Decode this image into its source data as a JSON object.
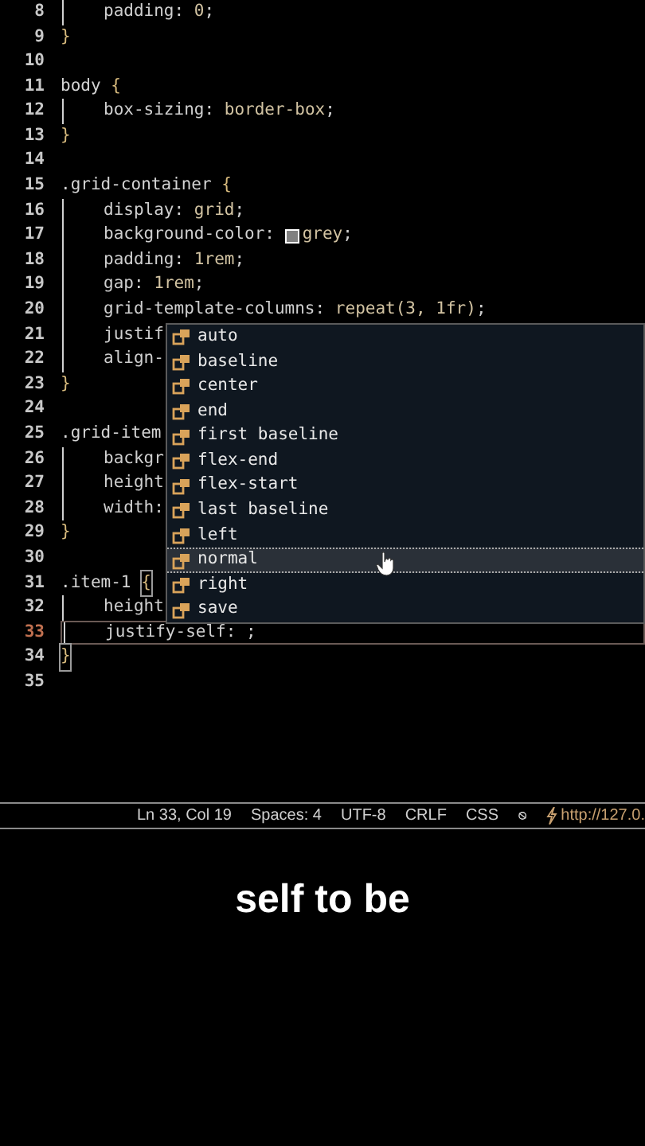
{
  "editor": {
    "lines": [
      {
        "number": "8",
        "guide": true,
        "current": false,
        "segments": [
          {
            "kind": "property",
            "text": "padding"
          },
          {
            "kind": "punct",
            "text": ": "
          },
          {
            "kind": "value",
            "text": "0"
          },
          {
            "kind": "punct",
            "text": ";"
          }
        ]
      },
      {
        "number": "9",
        "guide": false,
        "current": false,
        "segments": [
          {
            "kind": "brace",
            "text": "}"
          }
        ]
      },
      {
        "number": "10",
        "guide": false,
        "current": false
      },
      {
        "number": "11",
        "guide": false,
        "current": false,
        "segments": [
          {
            "kind": "selector",
            "text": "body "
          },
          {
            "kind": "brace",
            "text": "{"
          }
        ]
      },
      {
        "number": "12",
        "guide": true,
        "current": false,
        "segments": [
          {
            "kind": "property",
            "text": "box-sizing"
          },
          {
            "kind": "punct",
            "text": ": "
          },
          {
            "kind": "value",
            "text": "border-box"
          },
          {
            "kind": "punct",
            "text": ";"
          }
        ]
      },
      {
        "number": "13",
        "guide": false,
        "current": false,
        "segments": [
          {
            "kind": "brace",
            "text": "}"
          }
        ]
      },
      {
        "number": "14",
        "guide": false,
        "current": false
      },
      {
        "number": "15",
        "guide": false,
        "current": false,
        "segments": [
          {
            "kind": "selector",
            "text": ".grid-container "
          },
          {
            "kind": "brace",
            "text": "{"
          }
        ]
      },
      {
        "number": "16",
        "guide": true,
        "current": false,
        "segments": [
          {
            "kind": "property",
            "text": "display"
          },
          {
            "kind": "punct",
            "text": ": "
          },
          {
            "kind": "value",
            "text": "grid"
          },
          {
            "kind": "punct",
            "text": ";"
          }
        ]
      },
      {
        "number": "17",
        "guide": true,
        "current": false,
        "segments": [
          {
            "kind": "property",
            "text": "background-color"
          },
          {
            "kind": "punct",
            "text": ": "
          },
          {
            "kind": "swatch",
            "color": "#808080"
          },
          {
            "kind": "value",
            "text": "grey"
          },
          {
            "kind": "punct",
            "text": ";"
          }
        ]
      },
      {
        "number": "18",
        "guide": true,
        "current": false,
        "segments": [
          {
            "kind": "property",
            "text": "padding"
          },
          {
            "kind": "punct",
            "text": ": "
          },
          {
            "kind": "value",
            "text": "1rem"
          },
          {
            "kind": "punct",
            "text": ";"
          }
        ]
      },
      {
        "number": "19",
        "guide": true,
        "current": false,
        "segments": [
          {
            "kind": "property",
            "text": "gap"
          },
          {
            "kind": "punct",
            "text": ": "
          },
          {
            "kind": "value",
            "text": "1rem"
          },
          {
            "kind": "punct",
            "text": ";"
          }
        ]
      },
      {
        "number": "20",
        "guide": true,
        "current": false,
        "segments": [
          {
            "kind": "property",
            "text": "grid-template-columns"
          },
          {
            "kind": "punct",
            "text": ": "
          },
          {
            "kind": "value",
            "text": "repeat(3, 1fr)"
          },
          {
            "kind": "punct",
            "text": ";"
          }
        ]
      },
      {
        "number": "21",
        "guide": true,
        "current": false,
        "segments": [
          {
            "kind": "property",
            "text": "justif"
          }
        ]
      },
      {
        "number": "22",
        "guide": true,
        "current": false,
        "segments": [
          {
            "kind": "property",
            "text": "align-"
          }
        ]
      },
      {
        "number": "23",
        "guide": false,
        "current": false,
        "segments": [
          {
            "kind": "brace",
            "text": "}"
          }
        ]
      },
      {
        "number": "24",
        "guide": false,
        "current": false
      },
      {
        "number": "25",
        "guide": false,
        "current": false,
        "segments": [
          {
            "kind": "selector",
            "text": ".grid-item"
          }
        ]
      },
      {
        "number": "26",
        "guide": true,
        "current": false,
        "segments": [
          {
            "kind": "property",
            "text": "backgr"
          }
        ]
      },
      {
        "number": "27",
        "guide": true,
        "current": false,
        "segments": [
          {
            "kind": "property",
            "text": "height"
          }
        ]
      },
      {
        "number": "28",
        "guide": true,
        "current": false,
        "segments": [
          {
            "kind": "property",
            "text": "width:"
          }
        ]
      },
      {
        "number": "29",
        "guide": false,
        "current": false,
        "segments": [
          {
            "kind": "brace",
            "text": "}"
          }
        ]
      },
      {
        "number": "30",
        "guide": false,
        "current": false
      },
      {
        "number": "31",
        "guide": false,
        "current": false,
        "segments": [
          {
            "kind": "selector",
            "text": ".item-1 "
          },
          {
            "kind": "brace_match",
            "text": "{"
          }
        ]
      },
      {
        "number": "32",
        "guide": true,
        "current": false,
        "segments": [
          {
            "kind": "property",
            "text": "height"
          }
        ]
      },
      {
        "number": "33",
        "guide": true,
        "current": true,
        "segments": [
          {
            "kind": "property",
            "text": "justify-self"
          },
          {
            "kind": "punct",
            "text": ": "
          },
          {
            "kind": "punct",
            "text": ";"
          }
        ]
      },
      {
        "number": "34",
        "guide": false,
        "current": false,
        "segments": [
          {
            "kind": "brace_match",
            "text": "}"
          }
        ]
      },
      {
        "number": "35",
        "guide": false,
        "current": false
      }
    ]
  },
  "suggestions": [
    {
      "label": "auto",
      "selected": false
    },
    {
      "label": "baseline",
      "selected": false
    },
    {
      "label": "center",
      "selected": false
    },
    {
      "label": "end",
      "selected": false
    },
    {
      "label": "first baseline",
      "selected": false
    },
    {
      "label": "flex-end",
      "selected": false
    },
    {
      "label": "flex-start",
      "selected": false
    },
    {
      "label": "last baseline",
      "selected": false
    },
    {
      "label": "left",
      "selected": false
    },
    {
      "label": "normal",
      "selected": true
    },
    {
      "label": "right",
      "selected": false
    },
    {
      "label": "save",
      "selected": false
    }
  ],
  "status_bar": {
    "items": [
      "Ln 33, Col 19",
      "Spaces: 4",
      "UTF-8",
      "CRLF",
      "CSS"
    ],
    "live_server": "http://127.0."
  },
  "caption": "self to be"
}
